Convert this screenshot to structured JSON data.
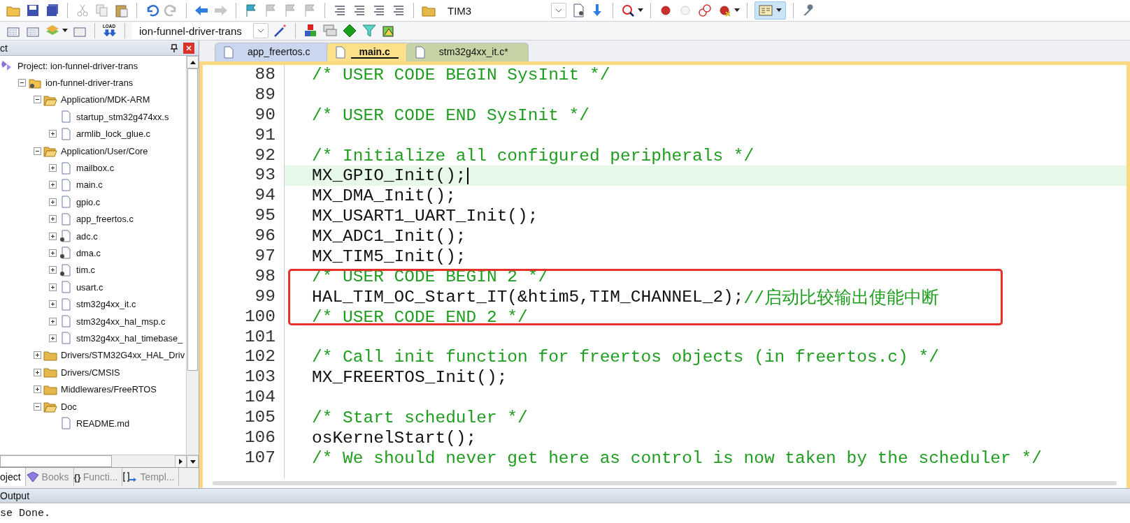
{
  "toolbar": {
    "find_combo": {
      "value": "TIM3"
    },
    "layout_button": {
      "selected": true
    }
  },
  "build_toolbar": {
    "load_text": "LOAD",
    "target_combo": {
      "value": "ion-funnel-driver-trans"
    }
  },
  "project_panel": {
    "title": "ct",
    "tree": [
      {
        "label": "Project: ion-funnel-driver-trans",
        "kind": "project",
        "children": [
          {
            "label": "ion-funnel-driver-trans",
            "kind": "target",
            "expanded": true,
            "children": [
              {
                "label": "Application/MDK-ARM",
                "kind": "group",
                "expanded": true,
                "children": [
                  {
                    "label": "startup_stm32g474xx.s",
                    "kind": "file",
                    "options": false
                  },
                  {
                    "label": "armlib_lock_glue.c",
                    "kind": "file",
                    "expanded": false,
                    "options": false
                  }
                ]
              },
              {
                "label": "Application/User/Core",
                "kind": "group",
                "expanded": true,
                "children": [
                  {
                    "label": "mailbox.c",
                    "kind": "file",
                    "expanded": false,
                    "options": false
                  },
                  {
                    "label": "main.c",
                    "kind": "file",
                    "expanded": false,
                    "options": false
                  },
                  {
                    "label": "gpio.c",
                    "kind": "file",
                    "expanded": false,
                    "options": false
                  },
                  {
                    "label": "app_freertos.c",
                    "kind": "file",
                    "expanded": false,
                    "options": false
                  },
                  {
                    "label": "adc.c",
                    "kind": "file",
                    "expanded": false,
                    "options": true
                  },
                  {
                    "label": "dma.c",
                    "kind": "file",
                    "expanded": false,
                    "options": true
                  },
                  {
                    "label": "tim.c",
                    "kind": "file",
                    "expanded": false,
                    "options": true
                  },
                  {
                    "label": "usart.c",
                    "kind": "file",
                    "expanded": false,
                    "options": false
                  },
                  {
                    "label": "stm32g4xx_it.c",
                    "kind": "file",
                    "expanded": false,
                    "options": false
                  },
                  {
                    "label": "stm32g4xx_hal_msp.c",
                    "kind": "file",
                    "expanded": false,
                    "options": false
                  },
                  {
                    "label": "stm32g4xx_hal_timebase_",
                    "kind": "file",
                    "expanded": false,
                    "options": false
                  }
                ]
              },
              {
                "label": "Drivers/STM32G4xx_HAL_Driv",
                "kind": "group",
                "expanded": false
              },
              {
                "label": "Drivers/CMSIS",
                "kind": "group",
                "expanded": false
              },
              {
                "label": "Middlewares/FreeRTOS",
                "kind": "group",
                "expanded": false
              },
              {
                "label": "Doc",
                "kind": "group",
                "expanded": true,
                "children": [
                  {
                    "label": "README.md",
                    "kind": "file",
                    "options": false
                  }
                ]
              }
            ]
          }
        ]
      }
    ],
    "tabs": [
      {
        "label": "oject",
        "kind": "project",
        "selected": true
      },
      {
        "label": "Books",
        "kind": "books",
        "selected": false
      },
      {
        "label": "Functi...",
        "kind": "functions",
        "icon_text": "{}",
        "selected": false
      },
      {
        "label": "Templ...",
        "kind": "templates",
        "selected": false
      }
    ]
  },
  "editor": {
    "tabs": [
      {
        "label": "app_freertos.c",
        "selected": false,
        "color": "#c9d6ee"
      },
      {
        "label": "main.c",
        "selected": true,
        "color": "#fde08a"
      },
      {
        "label": "stm32g4xx_it.c*",
        "selected": false,
        "color": "#c7d3a4"
      }
    ],
    "lines": [
      {
        "number": "88",
        "comment": "/* USER CODE BEGIN SysInit */",
        "current": false,
        "boxed": false
      },
      {
        "number": "89",
        "current": false,
        "boxed": false
      },
      {
        "number": "90",
        "comment": "/* USER CODE END SysInit */",
        "current": false,
        "boxed": false
      },
      {
        "number": "91",
        "current": false,
        "boxed": false
      },
      {
        "number": "92",
        "comment": "/* Initialize all configured peripherals */",
        "current": false,
        "boxed": false
      },
      {
        "number": "93",
        "code": "MX_GPIO_Init();",
        "current": true,
        "boxed": false
      },
      {
        "number": "94",
        "code": "MX_DMA_Init();",
        "current": false,
        "boxed": false
      },
      {
        "number": "95",
        "code": "MX_USART1_UART_Init();",
        "current": false,
        "boxed": false
      },
      {
        "number": "96",
        "code": "MX_ADC1_Init();",
        "current": false,
        "boxed": false
      },
      {
        "number": "97",
        "code": "MX_TIM5_Init();",
        "current": false,
        "boxed": false
      },
      {
        "number": "98",
        "comment": "/* USER CODE BEGIN 2 */",
        "current": false,
        "boxed": true
      },
      {
        "number": "99",
        "code": "HAL_TIM_OC_Start_IT(&htim5,TIM_CHANNEL_2);",
        "comment": "//启动比较输出使能中断",
        "current": false,
        "boxed": true
      },
      {
        "number": "100",
        "comment": "/* USER CODE END 2 */",
        "current": false,
        "boxed": true
      },
      {
        "number": "101",
        "current": false,
        "boxed": false
      },
      {
        "number": "102",
        "comment": "/* Call init function for freertos objects (in freertos.c) */",
        "current": false,
        "boxed": false
      },
      {
        "number": "103",
        "code": "MX_FREERTOS_Init();",
        "current": false,
        "boxed": false
      },
      {
        "number": "104",
        "current": false,
        "boxed": false
      },
      {
        "number": "105",
        "comment": "/* Start scheduler */",
        "current": false,
        "boxed": false
      },
      {
        "number": "106",
        "code": "osKernelStart();",
        "current": false,
        "boxed": false
      },
      {
        "number": "107",
        "comment": "/* We should never get here as control is now taken by the scheduler */",
        "current": false,
        "boxed": false
      }
    ]
  },
  "output": {
    "title": "Output",
    "text": "se Done."
  }
}
